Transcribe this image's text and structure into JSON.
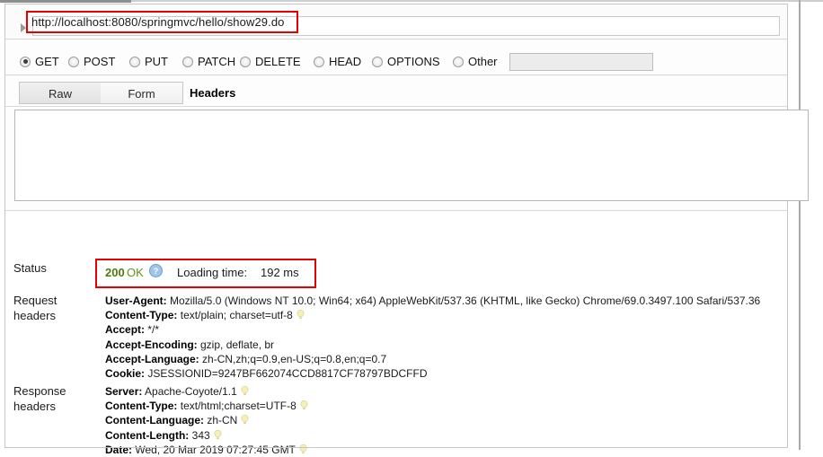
{
  "request": {
    "url": "http://localhost:8080/springmvc/hello/show29.do",
    "url_highlight_color": "#e60000",
    "disclosure_icon": "triangle-right-icon",
    "methods": [
      {
        "label": "GET",
        "selected": true
      },
      {
        "label": "POST",
        "selected": false
      },
      {
        "label": "PUT",
        "selected": false
      },
      {
        "label": "PATCH",
        "selected": false
      },
      {
        "label": "DELETE",
        "selected": false
      },
      {
        "label": "HEAD",
        "selected": false
      },
      {
        "label": "OPTIONS",
        "selected": false
      },
      {
        "label": "Other",
        "selected": false
      }
    ],
    "other_method_value": "",
    "tabs": [
      {
        "label": "Raw",
        "active": true
      },
      {
        "label": "Form",
        "active": false
      }
    ],
    "headers_tab_label": "Headers",
    "body_value": ""
  },
  "result": {
    "status_label": "Status",
    "status_code": "200",
    "status_text": "OK",
    "status_code_color": "#4f7a0f",
    "help_icon": "question-help-icon",
    "loading_time_label": "Loading time:",
    "loading_time_value": "192 ms",
    "status_highlight_color": "#e60000",
    "request_headers_label": "Request headers",
    "request_headers": [
      {
        "name": "User-Agent",
        "value": "Mozilla/5.0 (Windows NT 10.0; Win64; x64) AppleWebKit/537.36 (KHTML, like Gecko) Chrome/69.0.3497.100 Safari/537.36",
        "bulb": false
      },
      {
        "name": "Content-Type",
        "value": "text/plain; charset=utf-8",
        "bulb": true
      },
      {
        "name": "Accept",
        "value": "*/*",
        "bulb": false
      },
      {
        "name": "Accept-Encoding",
        "value": "gzip, deflate, br",
        "bulb": false
      },
      {
        "name": "Accept-Language",
        "value": "zh-CN,zh;q=0.9,en-US;q=0.8,en;q=0.7",
        "bulb": false
      },
      {
        "name": "Cookie",
        "value": "JSESSIONID=9247BF662074CCD8817CF78797BDCFFD",
        "bulb": false
      }
    ],
    "response_headers_label": "Response headers",
    "response_headers": [
      {
        "name": "Server",
        "value": "Apache-Coyote/1.1",
        "bulb": true
      },
      {
        "name": "Content-Type",
        "value": "text/html;charset=UTF-8",
        "bulb": true
      },
      {
        "name": "Content-Language",
        "value": "zh-CN",
        "bulb": true
      },
      {
        "name": "Content-Length",
        "value": "343",
        "bulb": true
      },
      {
        "name": "Date",
        "value": "Wed, 20 Mar 2019 07:27:45 GMT",
        "bulb": true
      }
    ]
  }
}
